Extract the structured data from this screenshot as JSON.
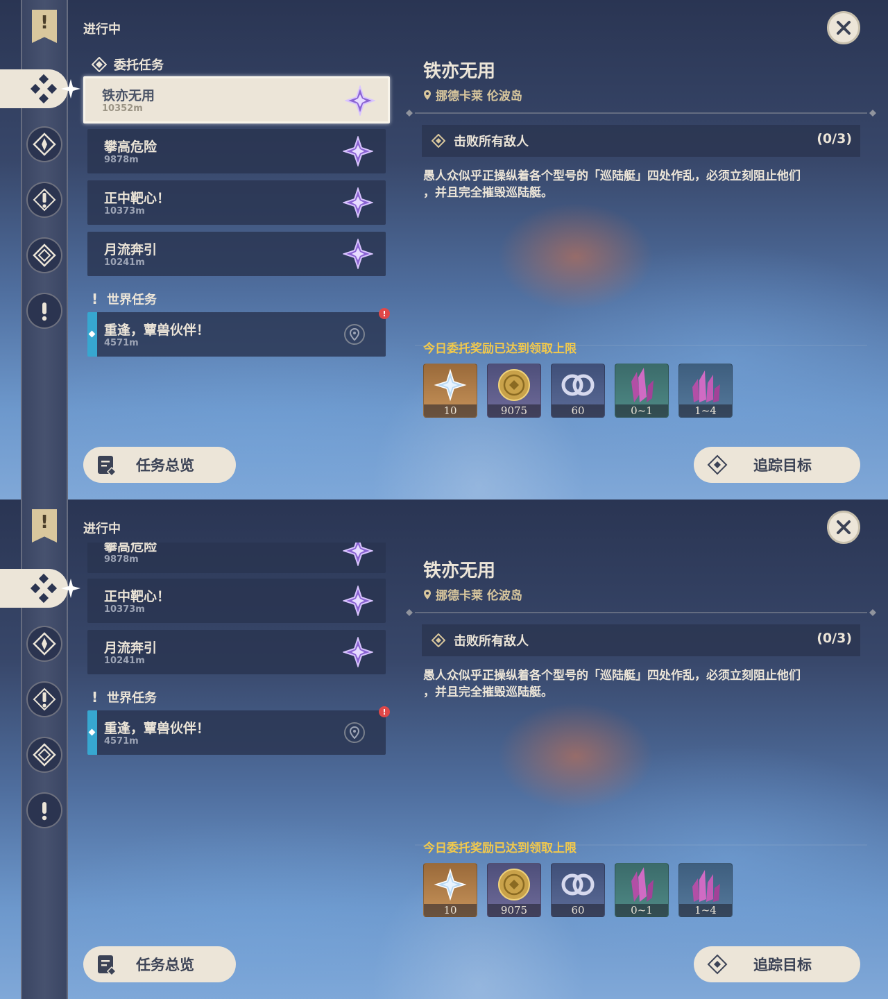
{
  "panels": [
    {
      "header": {
        "title": "进行中"
      },
      "commission_group": {
        "label": "委托任务"
      },
      "quests": [
        {
          "name": "铁亦无用",
          "distance": "10352m"
        },
        {
          "name": "攀高危险",
          "distance": "9878m"
        },
        {
          "name": "正中靶心！",
          "distance": "10373m"
        },
        {
          "name": "月流奔引",
          "distance": "10241m"
        }
      ],
      "world_group": {
        "label": "世界任务"
      },
      "world_quest": {
        "name": "重逢，蕈兽伙伴！",
        "distance": "4571m",
        "alert": "!"
      },
      "detail": {
        "title": "铁亦无用",
        "location": "挪德卡莱 伦波岛",
        "objective": "击败所有敌人",
        "progress": "(0/3)",
        "description_line1": "愚人众似乎正操纵着各个型号的「巡陆艇」四处作乱，必须立刻阻止他们",
        "description_line2": "，并且完全摧毁巡陆艇。",
        "reward_limit": "今日委托奖励已达到领取上限",
        "rewards": [
          {
            "icon": "primogem-icon",
            "qty": "10"
          },
          {
            "icon": "mora-icon",
            "qty": "9075"
          },
          {
            "icon": "companionship-exp-icon",
            "qty": "60"
          },
          {
            "icon": "crystal-green-icon",
            "qty": "0~1"
          },
          {
            "icon": "crystal-purple-icon",
            "qty": "1~4"
          }
        ]
      },
      "buttons": {
        "overview": "任务总览",
        "track": "追踪目标"
      }
    },
    {
      "header": {
        "title": "进行中"
      },
      "quests": [
        {
          "name": "攀高危险",
          "distance": "9878m"
        },
        {
          "name": "正中靶心！",
          "distance": "10373m"
        },
        {
          "name": "月流奔引",
          "distance": "10241m"
        }
      ],
      "world_group": {
        "label": "世界任务"
      },
      "world_quest": {
        "name": "重逢，蕈兽伙伴！",
        "distance": "4571m",
        "alert": "!"
      },
      "detail": {
        "title": "铁亦无用",
        "location": "挪德卡莱 伦波岛",
        "objective": "击败所有敌人",
        "progress": "(0/3)",
        "description_line1": "愚人众似乎正操纵着各个型号的「巡陆艇」四处作乱，必须立刻阻止他们",
        "description_line2": "，并且完全摧毁巡陆艇。",
        "reward_limit": "今日委托奖励已达到领取上限",
        "rewards": [
          {
            "icon": "primogem-icon",
            "qty": "10"
          },
          {
            "icon": "mora-icon",
            "qty": "9075"
          },
          {
            "icon": "companionship-exp-icon",
            "qty": "60"
          },
          {
            "icon": "crystal-green-icon",
            "qty": "0~1"
          },
          {
            "icon": "crystal-purple-icon",
            "qty": "1~4"
          }
        ]
      },
      "buttons": {
        "overview": "任务总览",
        "track": "追踪目标"
      }
    }
  ],
  "colors": {
    "accent_cream": "#ece5d8",
    "world_quest_bar": "#37a7d0",
    "limit_text": "#f2c94c",
    "alert_red": "#e04848",
    "commission_star": "#8a63d2"
  }
}
